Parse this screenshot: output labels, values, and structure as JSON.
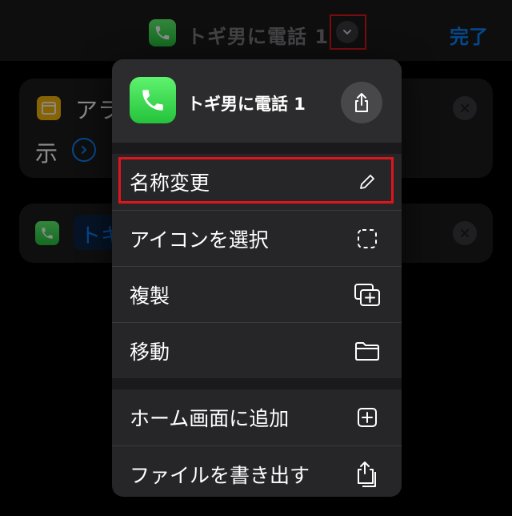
{
  "nav": {
    "title": "トギ男に電話 1",
    "done_label": "完了"
  },
  "cards": {
    "card1_line1": "アラ",
    "card1_line2": "示",
    "card2_token": "トキ"
  },
  "menu": {
    "header_title": "トギ男に電話 1",
    "items": [
      {
        "label": "名称変更",
        "icon": "pencil-icon"
      },
      {
        "label": "アイコンを選択",
        "icon": "dashed-square-icon"
      },
      {
        "label": "複製",
        "icon": "duplicate-icon"
      },
      {
        "label": "移動",
        "icon": "folder-icon"
      },
      {
        "label": "ホーム画面に追加",
        "icon": "plus-square-icon"
      },
      {
        "label": "ファイルを書き出す",
        "icon": "share-icon"
      }
    ]
  },
  "colors": {
    "accent": "#0a84ff",
    "highlight": "#e0151c",
    "phone_green": "#34c759",
    "alert_yellow": "#f5b60c"
  }
}
